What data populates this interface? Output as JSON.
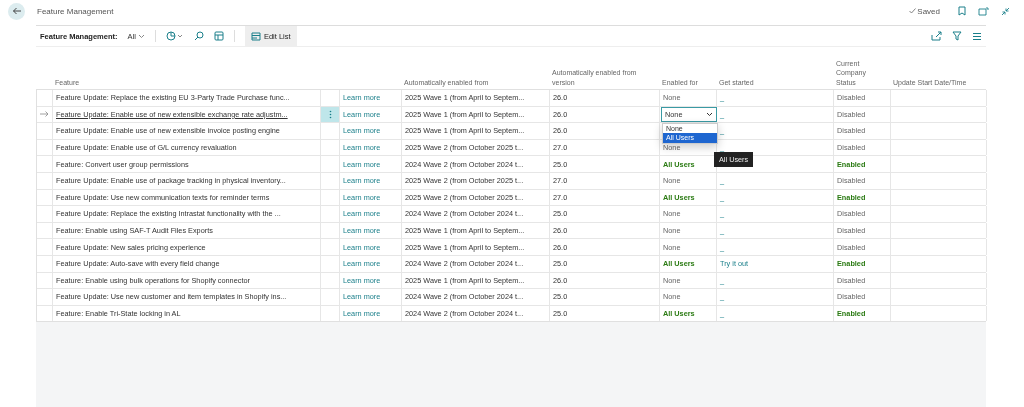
{
  "page": {
    "title": "Feature Management",
    "saved": "Saved"
  },
  "toolbar": {
    "label": "Feature Management:",
    "view": "All",
    "edit_list": "Edit List"
  },
  "table": {
    "columns": [
      "Feature",
      "Automatically enabled from",
      "Automatically enabled from version",
      "Enabled for",
      "Get started",
      "Current Company Status",
      "Update Start Date/Time"
    ],
    "rows": [
      {
        "feature": "Feature Update: Replace the existing EU 3-Party Trade Purchase func...",
        "link": "Learn more",
        "from": "2025 Wave 1 (from April to Septem...",
        "version": "26.0",
        "enabled_for": "None",
        "get_started": "_",
        "status": "Disabled",
        "enabled": false,
        "selected": false
      },
      {
        "feature": "Feature Update: Enable use of new extensible exchange rate adjustm...",
        "link": "Learn more",
        "from": "2025 Wave 1 (from April to Septem...",
        "version": "26.0",
        "enabled_for": "None",
        "get_started": "_",
        "status": "Disabled",
        "enabled": false,
        "selected": true,
        "dropdown": {
          "options": [
            {
              "label": "None",
              "selected": false
            },
            {
              "label": "All Users",
              "selected": true
            }
          ],
          "tooltip": "All Users"
        }
      },
      {
        "feature": "Feature Update: Enable use of new extensible invoice posting engine",
        "link": "Learn more",
        "from": "2025 Wave 1 (from April to Septem...",
        "version": "26.0",
        "get_started": "_",
        "status": "Disabled",
        "enabled": false,
        "selected": false
      },
      {
        "feature": "Feature Update: Enable use of G/L currency revaluation",
        "link": "Learn more",
        "from": "2025 Wave 2 (from October 2025 t...",
        "version": "27.0",
        "enabled_for": "None",
        "get_started": "_",
        "status": "Disabled",
        "enabled": false,
        "selected": false
      },
      {
        "feature": "Feature: Convert user group permissions",
        "link": "Learn more",
        "from": "2024 Wave 2 (from October 2024 t...",
        "version": "25.0",
        "enabled_for": "All Users",
        "status": "Enabled",
        "enabled": true,
        "selected": false
      },
      {
        "feature": "Feature Update: Enable use of package tracking in physical inventory...",
        "link": "Learn more",
        "from": "2025 Wave 2 (from October 2025 t...",
        "version": "27.0",
        "enabled_for": "None",
        "get_started": "_",
        "status": "Disabled",
        "enabled": false,
        "selected": false
      },
      {
        "feature": "Feature Update: Use new communication texts for reminder terms",
        "link": "Learn more",
        "from": "2025 Wave 2 (from October 2025 t...",
        "version": "27.0",
        "enabled_for": "All Users",
        "get_started": "_",
        "status": "Enabled",
        "enabled": true,
        "selected": false
      },
      {
        "feature": "Feature Update: Replace the existing Intrastat functionality with the ...",
        "link": "Learn more",
        "from": "2024 Wave 2 (from October 2024 t...",
        "version": "25.0",
        "enabled_for": "None",
        "get_started": "_",
        "status": "Disabled",
        "enabled": false,
        "selected": false
      },
      {
        "feature": "Feature: Enable using SAF-T Audit Files Exports",
        "link": "Learn more",
        "from": "2025 Wave 1 (from April to Septem...",
        "version": "26.0",
        "enabled_for": "None",
        "get_started": "_",
        "status": "Disabled",
        "enabled": false,
        "selected": false
      },
      {
        "feature": "Feature Update: New sales pricing experience",
        "link": "Learn more",
        "from": "2025 Wave 1 (from April to Septem...",
        "version": "26.0",
        "enabled_for": "None",
        "get_started": "_",
        "status": "Disabled",
        "enabled": false,
        "selected": false
      },
      {
        "feature": "Feature Update: Auto-save with every field change",
        "link": "Learn more",
        "from": "2024 Wave 2 (from October 2024 t...",
        "version": "25.0",
        "enabled_for": "All Users",
        "get_started": "Try it out",
        "status": "Enabled",
        "enabled": true,
        "selected": false
      },
      {
        "feature": "Feature: Enable using bulk operations for Shopify connector",
        "link": "Learn more",
        "from": "2025 Wave 1 (from April to Septem...",
        "version": "26.0",
        "enabled_for": "None",
        "get_started": "_",
        "status": "Disabled",
        "enabled": false,
        "selected": false
      },
      {
        "feature": "Feature Update: Use new customer and item templates in Shopify ins...",
        "link": "Learn more",
        "from": "2024 Wave 2 (from October 2024 t...",
        "version": "25.0",
        "enabled_for": "None",
        "get_started": "_",
        "status": "Disabled",
        "enabled": false,
        "selected": false
      },
      {
        "feature": "Feature: Enable Tri-State locking in AL",
        "link": "Learn more",
        "from": "2024 Wave 2 (from October 2024 t...",
        "version": "25.0",
        "enabled_for": "All Users",
        "get_started": "_",
        "status": "Enabled",
        "enabled": true,
        "selected": false
      }
    ]
  }
}
